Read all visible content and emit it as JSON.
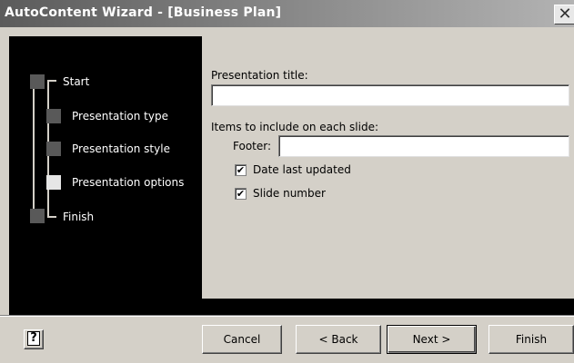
{
  "window": {
    "title": "AutoContent Wizard - [Business Plan]",
    "close_glyph": "✕"
  },
  "steps": [
    {
      "label": "Start",
      "state": "done"
    },
    {
      "label": "Presentation type",
      "state": "done"
    },
    {
      "label": "Presentation style",
      "state": "done"
    },
    {
      "label": "Presentation options",
      "state": "current"
    },
    {
      "label": "Finish",
      "state": "pending"
    }
  ],
  "form": {
    "title_label": "Presentation title:",
    "title_value": "",
    "items_label": "Items to include on each slide:",
    "footer_label": "Footer:",
    "footer_value": "",
    "date_label": "Date last updated",
    "date_checked": true,
    "slide_number_label": "Slide number",
    "slide_number_checked": true,
    "check_glyph": "✔"
  },
  "buttons": {
    "help_glyph": "?",
    "cancel": "Cancel",
    "back": "< Back",
    "next": "Next >",
    "finish": "Finish"
  }
}
